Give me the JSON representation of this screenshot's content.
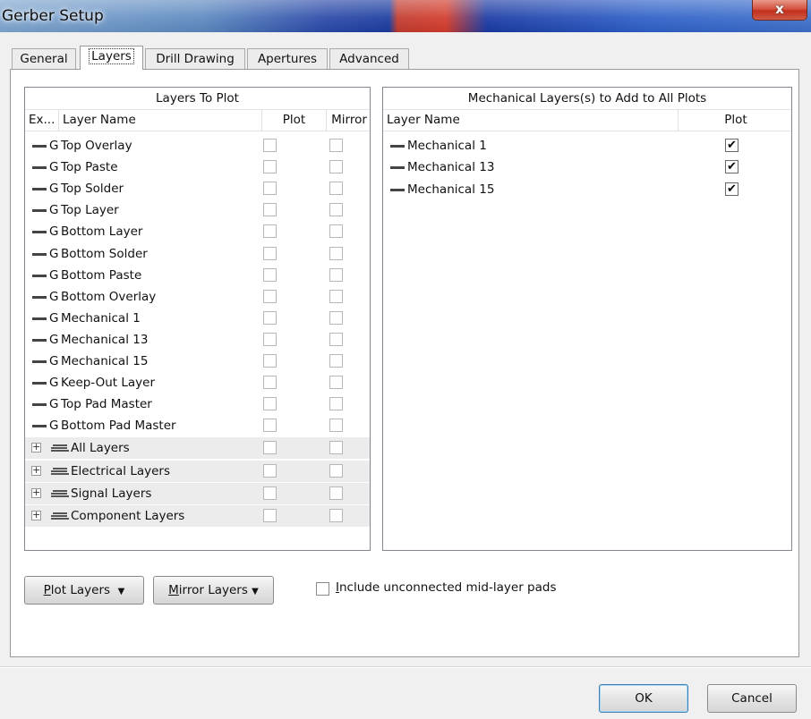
{
  "window": {
    "title": "Gerber Setup",
    "close_label": "x"
  },
  "tabs": [
    {
      "label": "General",
      "active": false
    },
    {
      "label": "Layers",
      "active": true
    },
    {
      "label": "Drill Drawing",
      "active": false
    },
    {
      "label": "Apertures",
      "active": false
    },
    {
      "label": "Advanced",
      "active": false
    }
  ],
  "layers_to_plot": {
    "title": "Layers To Plot",
    "columns": {
      "ext": "Ex...",
      "name": "Layer Name",
      "plot": "Plot",
      "mirror": "Mirror"
    },
    "rows": [
      {
        "tag": "G",
        "name": "Top Overlay",
        "plot": false,
        "mirror": false
      },
      {
        "tag": "G",
        "name": "Top Paste",
        "plot": false,
        "mirror": false
      },
      {
        "tag": "G",
        "name": "Top Solder",
        "plot": false,
        "mirror": false
      },
      {
        "tag": "G",
        "name": "Top Layer",
        "plot": false,
        "mirror": false
      },
      {
        "tag": "G",
        "name": "Bottom Layer",
        "plot": false,
        "mirror": false
      },
      {
        "tag": "G",
        "name": "Bottom Solder",
        "plot": false,
        "mirror": false
      },
      {
        "tag": "G",
        "name": "Bottom Paste",
        "plot": false,
        "mirror": false
      },
      {
        "tag": "G",
        "name": "Bottom Overlay",
        "plot": false,
        "mirror": false
      },
      {
        "tag": "G",
        "name": "Mechanical 1",
        "plot": false,
        "mirror": false
      },
      {
        "tag": "G",
        "name": "Mechanical 13",
        "plot": false,
        "mirror": false
      },
      {
        "tag": "G",
        "name": "Mechanical 15",
        "plot": false,
        "mirror": false
      },
      {
        "tag": "G",
        "name": "Keep-Out Layer",
        "plot": false,
        "mirror": false
      },
      {
        "tag": "G",
        "name": "Top Pad Master",
        "plot": false,
        "mirror": false
      },
      {
        "tag": "G",
        "name": "Bottom Pad Master",
        "plot": false,
        "mirror": false
      }
    ],
    "groups": [
      {
        "name": "All Layers",
        "expander": "+",
        "plot": false,
        "mirror": false
      },
      {
        "name": "Electrical Layers",
        "expander": "+",
        "plot": false,
        "mirror": false
      },
      {
        "name": "Signal Layers",
        "expander": "+",
        "plot": false,
        "mirror": false
      },
      {
        "name": "Component Layers",
        "expander": "+",
        "plot": false,
        "mirror": false
      }
    ]
  },
  "mechanical_layers": {
    "title": "Mechanical Layers(s) to Add to All Plots",
    "columns": {
      "name": "Layer Name",
      "plot": "Plot"
    },
    "rows": [
      {
        "name": "Mechanical 1",
        "plot": true
      },
      {
        "name": "Mechanical 13",
        "plot": true
      },
      {
        "name": "Mechanical 15",
        "plot": true
      }
    ]
  },
  "buttons": {
    "plot_layers": {
      "accel": "P",
      "rest": "lot Layers",
      "arrow": "▼"
    },
    "mirror_layers": {
      "accel": "M",
      "rest": "irror Layers",
      "arrow": "▼"
    },
    "ok": "OK",
    "cancel": "Cancel"
  },
  "options": {
    "include_unconnected": {
      "accel": "I",
      "rest": "nclude unconnected mid-layer pads",
      "checked": false
    }
  }
}
